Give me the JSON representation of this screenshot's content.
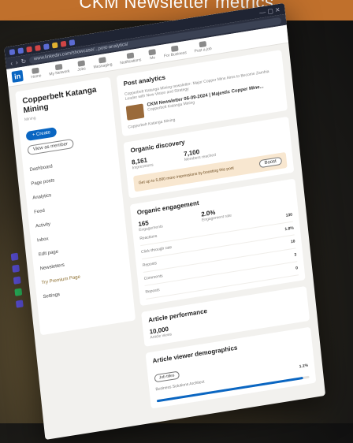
{
  "banner": {
    "text": "CKM Newsletter metrics"
  },
  "browser": {
    "url": "www.linkedin.com/showcase/...post-analytics/",
    "win_controls": "— ▢ ✕"
  },
  "linkedin": {
    "logo": "in",
    "nav": [
      "Home",
      "My Network",
      "Jobs",
      "Messaging",
      "Notifications",
      "Me",
      "For Business",
      "Post a job"
    ]
  },
  "left_panel": {
    "company": "Copperbelt Katanga Mining",
    "subtitle": "Mining",
    "create_label": "+ Create",
    "view_member_label": "View as member",
    "menu": [
      "Dashboard",
      "Page posts",
      "Analytics",
      "Feed",
      "Activity",
      "Inbox",
      "Edit page",
      "Newsletters"
    ],
    "premium": "Try Premium Page",
    "settings": "Settings"
  },
  "post_analytics": {
    "title": "Post analytics",
    "desc": "Copperbelt Katanga Mining newsletter: Major Copper Mine Aims to Become Zambia Leader with New Vision and Strategy",
    "post_title": "CKM Newsletter 06-09-2024 | Majestic Copper Mine...",
    "post_sub": "Copperbelt Katanga Mining",
    "footer": "Copperbelt Katanga Mining"
  },
  "organic_discovery": {
    "title": "Organic discovery",
    "impressions": "8,161",
    "impressions_label": "Impressions",
    "members_reached": "7,100",
    "members_reached_label": "Members reached",
    "boost_text": "Get up to 5,000 more impressions by boosting this post",
    "boost_button": "Boost"
  },
  "organic_engagement": {
    "title": "Organic engagement",
    "reactions": "165",
    "reactions_label": "Engagements",
    "engagement_rate": "2.0%",
    "engagement_rate_label": "Engagement rate",
    "rows": [
      {
        "label": "Reactions",
        "value": "130"
      },
      {
        "label": "Click-through rate",
        "value": "1.8%"
      },
      {
        "label": "Reposts",
        "value": "10"
      },
      {
        "label": "Comments",
        "value": "3"
      },
      {
        "label": "Reposts",
        "value": "0"
      }
    ]
  },
  "article_performance": {
    "title": "Article performance",
    "views": "10,000",
    "views_label": "Article views"
  },
  "demographics": {
    "title": "Article viewer demographics",
    "select": "Job titles",
    "top_item": "Business Solutions Architect",
    "top_pct": "1.1%",
    "bar_fraction": 0.96
  },
  "colors": {
    "banner": "#c0702c",
    "linkedin_blue": "#0a66c2"
  }
}
